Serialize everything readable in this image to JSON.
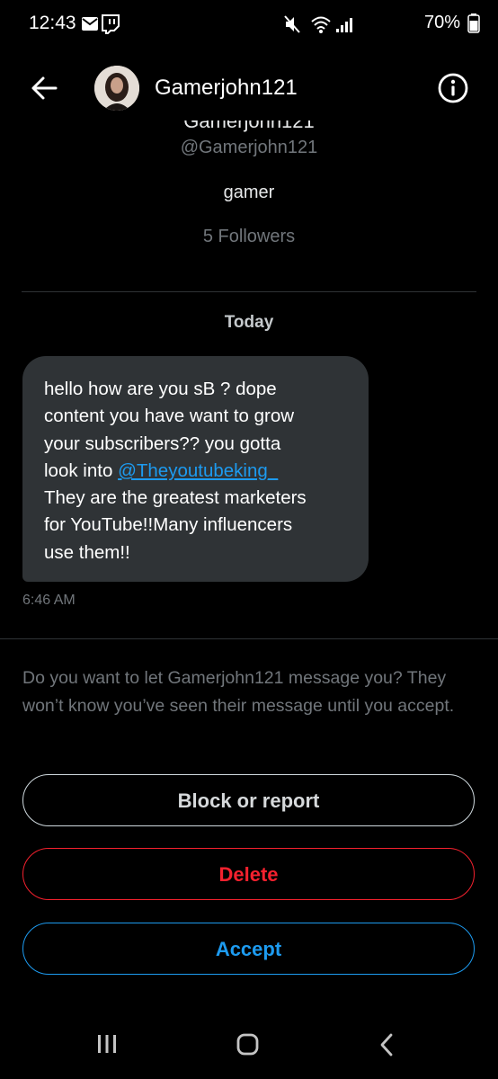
{
  "status_bar": {
    "time": "12:43",
    "battery": "70%"
  },
  "header": {
    "username": "Gamerjohn121"
  },
  "profile": {
    "name_cut": "Gamerjohn121",
    "handle": "@Gamerjohn121",
    "bio": "gamer",
    "followers": "5 Followers"
  },
  "conversation": {
    "date_label": "Today",
    "message": {
      "lines": [
        "hello how are you sB ? dope",
        "content you have want to grow",
        "your subscribers?? you gotta",
        "look into "
      ],
      "link": "@Theyoutubeking_",
      "lines_after": [
        "They are the greatest marketers",
        "for YouTube!!Many influencers",
        "use them!!"
      ],
      "time": "6:46 AM"
    }
  },
  "request": {
    "prompt": "Do you want to let Gamerjohn121 message you? They won’t know you’ve seen their message until you accept.",
    "block_label": "Block or report",
    "delete_label": "Delete",
    "accept_label": "Accept"
  },
  "colors": {
    "background": "#000000",
    "accent": "#1d9bf0",
    "danger": "#f4212e",
    "bubble": "#2f3336",
    "muted": "#71767b"
  },
  "icons": {
    "status_left": [
      "mail-icon",
      "twitch-icon"
    ],
    "status_right": [
      "mute-icon",
      "wifi-icon",
      "signal-icon",
      "battery-icon"
    ],
    "header": [
      "back-arrow-icon",
      "info-icon"
    ],
    "nav": [
      "recents-icon",
      "home-icon",
      "nav-back-icon"
    ]
  }
}
